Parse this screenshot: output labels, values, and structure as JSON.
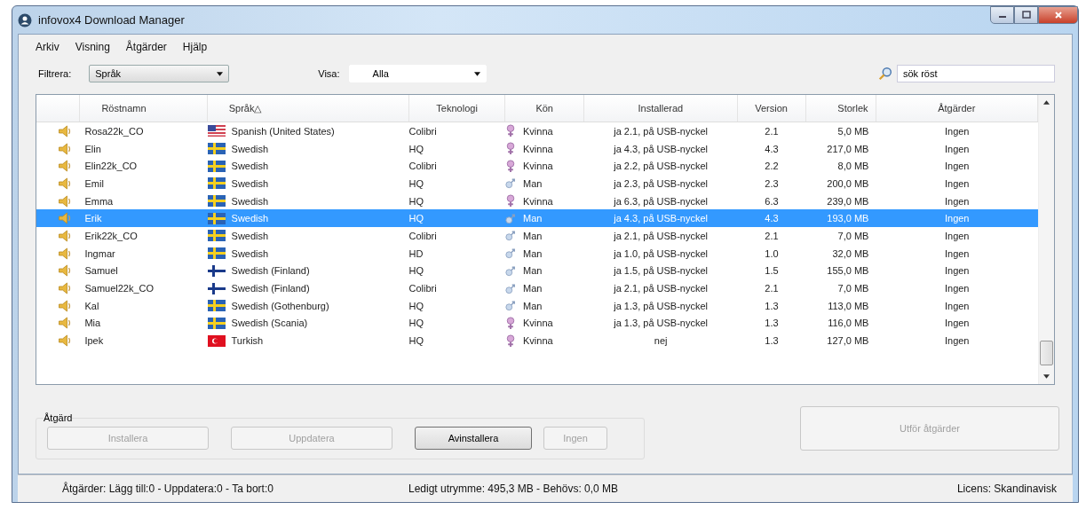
{
  "window": {
    "title": "infovox4 Download Manager"
  },
  "menu": [
    {
      "label": "Arkiv"
    },
    {
      "label": "Visning"
    },
    {
      "label": "Åtgärder"
    },
    {
      "label": "Hjälp"
    }
  ],
  "filter": {
    "label": "Filtrera:",
    "value": "Språk"
  },
  "show": {
    "label": "Visa:",
    "value": "Alla"
  },
  "search": {
    "value": "sök röst"
  },
  "table": {
    "columns": [
      {
        "label": "Röstnamn"
      },
      {
        "label": "Språk△"
      },
      {
        "label": "Teknologi"
      },
      {
        "label": "Kön"
      },
      {
        "label": "Installerad"
      },
      {
        "label": "Version"
      },
      {
        "label": "Storlek"
      },
      {
        "label": "Åtgärder"
      }
    ],
    "rows": [
      {
        "name": "Rosa22k_CO",
        "flag": {
          "kind": "us"
        },
        "language": "Spanish (United States)",
        "technology": "Colibri",
        "gender": {
          "kind": "female",
          "label": "Kvinna"
        },
        "installed": "ja 2.1, på USB-nyckel",
        "version": "2.1",
        "size": "5,0 MB",
        "action": "Ingen",
        "selected": false
      },
      {
        "name": "Elin",
        "flag": {
          "kind": "se"
        },
        "language": "Swedish",
        "technology": "HQ",
        "gender": {
          "kind": "female",
          "label": "Kvinna"
        },
        "installed": "ja 4.3, på USB-nyckel",
        "version": "4.3",
        "size": "217,0 MB",
        "action": "Ingen",
        "selected": false
      },
      {
        "name": "Elin22k_CO",
        "flag": {
          "kind": "se"
        },
        "language": "Swedish",
        "technology": "Colibri",
        "gender": {
          "kind": "female",
          "label": "Kvinna"
        },
        "installed": "ja 2.2, på USB-nyckel",
        "version": "2.2",
        "size": "8,0 MB",
        "action": "Ingen",
        "selected": false
      },
      {
        "name": "Emil",
        "flag": {
          "kind": "se"
        },
        "language": "Swedish",
        "technology": "HQ",
        "gender": {
          "kind": "male",
          "label": "Man"
        },
        "installed": "ja 2.3, på USB-nyckel",
        "version": "2.3",
        "size": "200,0 MB",
        "action": "Ingen",
        "selected": false
      },
      {
        "name": "Emma",
        "flag": {
          "kind": "se"
        },
        "language": "Swedish",
        "technology": "HQ",
        "gender": {
          "kind": "female",
          "label": "Kvinna"
        },
        "installed": "ja 6.3, på USB-nyckel",
        "version": "6.3",
        "size": "239,0 MB",
        "action": "Ingen",
        "selected": false
      },
      {
        "name": "Erik",
        "flag": {
          "kind": "se"
        },
        "language": "Swedish",
        "technology": "HQ",
        "gender": {
          "kind": "male",
          "label": "Man"
        },
        "installed": "ja 4.3, på USB-nyckel",
        "version": "4.3",
        "size": "193,0 MB",
        "action": "Ingen",
        "selected": true
      },
      {
        "name": "Erik22k_CO",
        "flag": {
          "kind": "se"
        },
        "language": "Swedish",
        "technology": "Colibri",
        "gender": {
          "kind": "male",
          "label": "Man"
        },
        "installed": "ja 2.1, på USB-nyckel",
        "version": "2.1",
        "size": "7,0 MB",
        "action": "Ingen",
        "selected": false
      },
      {
        "name": "Ingmar",
        "flag": {
          "kind": "se"
        },
        "language": "Swedish",
        "technology": "HD",
        "gender": {
          "kind": "male",
          "label": "Man"
        },
        "installed": "ja 1.0, på USB-nyckel",
        "version": "1.0",
        "size": "32,0 MB",
        "action": "Ingen",
        "selected": false
      },
      {
        "name": "Samuel",
        "flag": {
          "kind": "fi"
        },
        "language": "Swedish (Finland)",
        "technology": "HQ",
        "gender": {
          "kind": "male",
          "label": "Man"
        },
        "installed": "ja 1.5, på USB-nyckel",
        "version": "1.5",
        "size": "155,0 MB",
        "action": "Ingen",
        "selected": false
      },
      {
        "name": "Samuel22k_CO",
        "flag": {
          "kind": "fi"
        },
        "language": "Swedish (Finland)",
        "technology": "Colibri",
        "gender": {
          "kind": "male",
          "label": "Man"
        },
        "installed": "ja 2.1, på USB-nyckel",
        "version": "2.1",
        "size": "7,0 MB",
        "action": "Ingen",
        "selected": false
      },
      {
        "name": "Kal",
        "flag": {
          "kind": "se"
        },
        "language": "Swedish (Gothenburg)",
        "technology": "HQ",
        "gender": {
          "kind": "male",
          "label": "Man"
        },
        "installed": "ja 1.3, på USB-nyckel",
        "version": "1.3",
        "size": "113,0 MB",
        "action": "Ingen",
        "selected": false
      },
      {
        "name": "Mia",
        "flag": {
          "kind": "se"
        },
        "language": "Swedish (Scania)",
        "technology": "HQ",
        "gender": {
          "kind": "female",
          "label": "Kvinna"
        },
        "installed": "ja 1.3, på USB-nyckel",
        "version": "1.3",
        "size": "116,0 MB",
        "action": "Ingen",
        "selected": false
      },
      {
        "name": "Ipek",
        "flag": {
          "kind": "tr"
        },
        "language": "Turkish",
        "technology": "HQ",
        "gender": {
          "kind": "female",
          "label": "Kvinna"
        },
        "installed": "nej",
        "version": "1.3",
        "size": "127,0 MB",
        "action": "Ingen",
        "selected": false
      }
    ]
  },
  "action_group": {
    "title": "Åtgärd",
    "buttons": [
      {
        "label": "Installera",
        "disabled": true
      },
      {
        "label": "Uppdatera",
        "disabled": true
      },
      {
        "label": "Avinstallera",
        "disabled": false
      },
      {
        "label": "Ingen",
        "disabled": true
      }
    ],
    "execute": {
      "label": "Utför åtgärder",
      "disabled": true
    }
  },
  "status_bar": {
    "actions": "Åtgärder: Lägg till:0 - Uppdatera:0 - Ta bort:0",
    "space": "Ledigt utrymme: 495,3 MB - Behövs: 0,0 MB",
    "license": "Licens: Skandinavisk"
  }
}
